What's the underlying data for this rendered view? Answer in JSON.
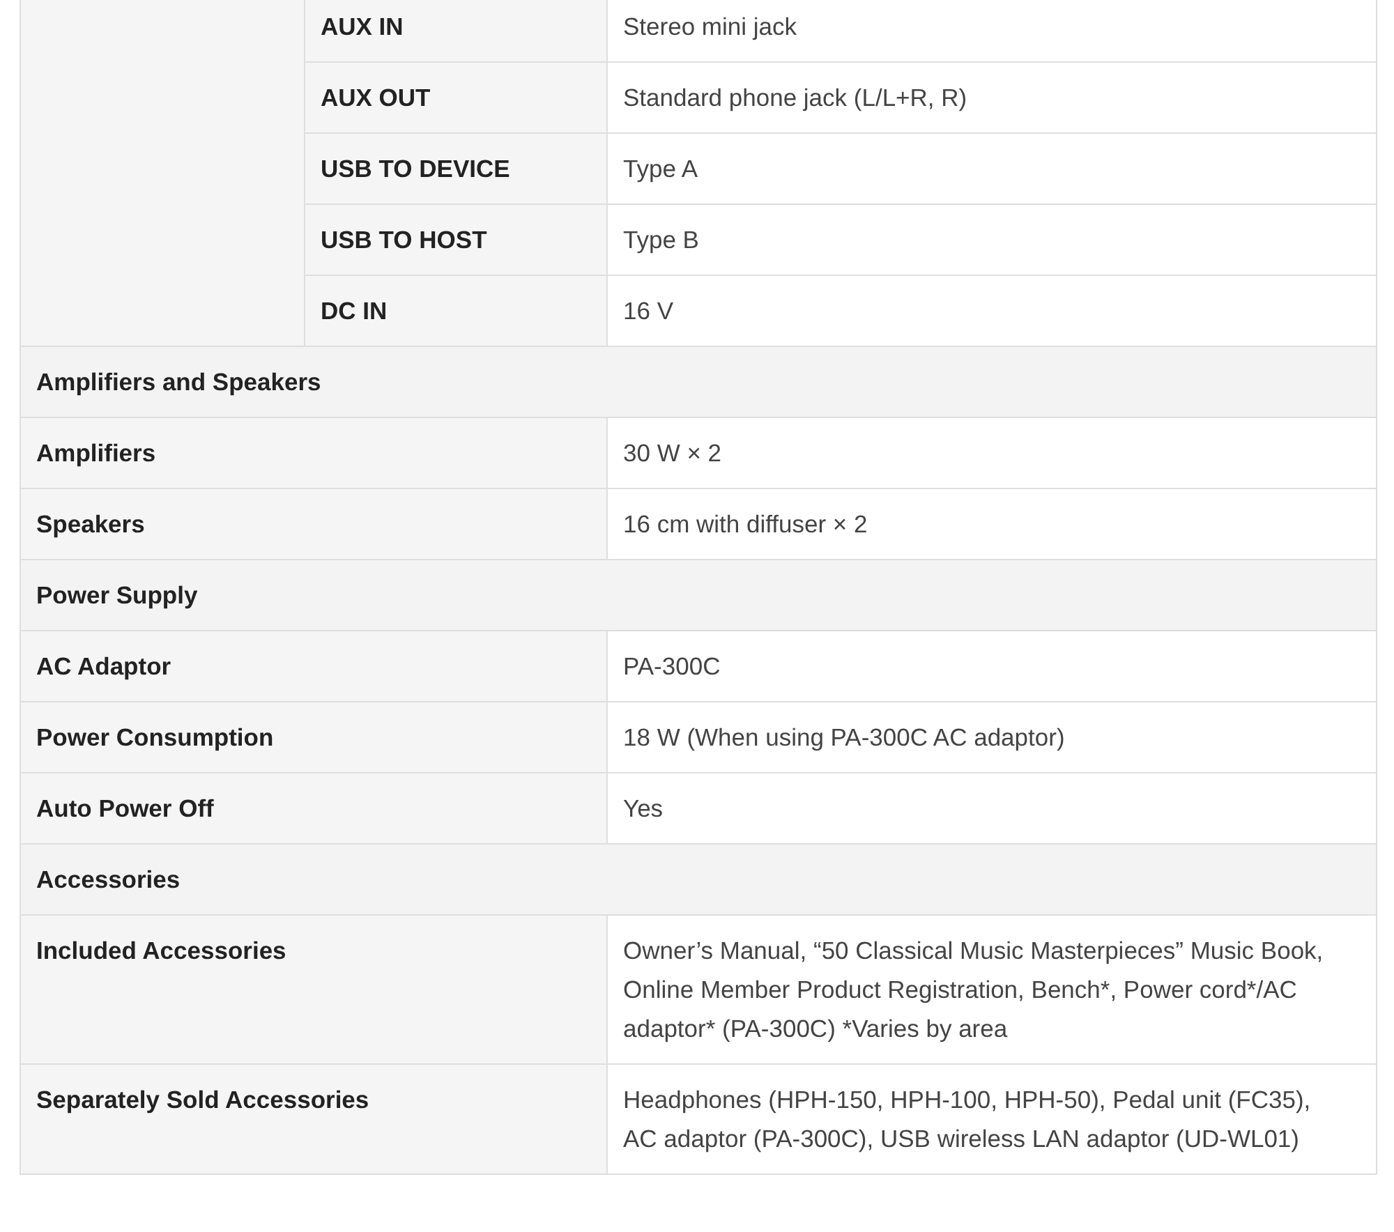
{
  "spec_table": {
    "rows": [
      {
        "kind": "subgroup",
        "items": [
          {
            "label": "AUX IN",
            "value": "Stereo mini jack"
          },
          {
            "label": "AUX OUT",
            "value": "Standard phone jack (L/L+R, R)"
          },
          {
            "label": "USB TO DEVICE",
            "value": "Type A"
          },
          {
            "label": "USB TO HOST",
            "value": "Type B"
          },
          {
            "label": "DC IN",
            "value": "16 V"
          }
        ]
      },
      {
        "kind": "section",
        "label": "Amplifiers and Speakers"
      },
      {
        "kind": "spec",
        "label": "Amplifiers",
        "value": "30 W × 2"
      },
      {
        "kind": "spec",
        "label": "Speakers",
        "value": "16 cm with diffuser × 2"
      },
      {
        "kind": "section",
        "label": "Power Supply"
      },
      {
        "kind": "spec",
        "label": "AC Adaptor",
        "value": "PA-300C"
      },
      {
        "kind": "spec",
        "label": "Power Consumption",
        "value": "18 W (When using PA-300C AC adaptor)"
      },
      {
        "kind": "spec",
        "label": "Auto Power Off",
        "value": "Yes"
      },
      {
        "kind": "section",
        "label": "Accessories"
      },
      {
        "kind": "spec",
        "label": "Included Accessories",
        "value": "Owner’s Manual, “50 Classical Music Masterpieces” Music Book, Online Member Product Registration, Bench*, Power cord*/AC adaptor* (PA-300C) *Varies by area"
      },
      {
        "kind": "spec",
        "label": "Separately Sold Accessories",
        "value": "Headphones (HPH-150, HPH-100, HPH-50), Pedal unit (FC35), AC adaptor (PA-300C), USB wireless LAN adaptor (UD-WL01)"
      }
    ]
  }
}
